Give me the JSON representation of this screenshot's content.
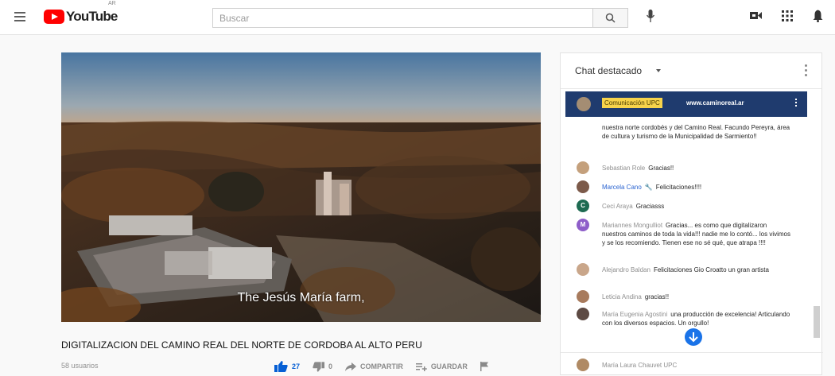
{
  "header": {
    "logo_text": "YouTube",
    "logo_suffix": "AR",
    "search_placeholder": "Buscar"
  },
  "video": {
    "subtitle": "The Jesús María farm,",
    "title": "DIGITALIZACION DEL CAMINO REAL DEL NORTE DE CORDOBA AL ALTO PERU",
    "viewers": "58 usuarios",
    "likes": "27",
    "dislikes": "0",
    "share_label": "COMPARTIR",
    "save_label": "GUARDAR"
  },
  "chat": {
    "title": "Chat destacado",
    "pinned": {
      "author": "Comunicación UPC",
      "text": "www.caminoreal.ar"
    },
    "messages": [
      {
        "author": "",
        "text": "nuestra norte cordobés y del Camino Real. Facundo Pereyra, área de cultura y turismo de la Municipalidad de Sarmiento!!",
        "avatar_color": "",
        "initial": ""
      },
      {
        "author": "Sebastian Role",
        "text": "Gracias!!",
        "avatar_color": "#c4a07c",
        "initial": ""
      },
      {
        "author": "Marcela Cano",
        "text": "Felicitaciones!!!!",
        "avatar_color": "#7c5a4a",
        "initial": "",
        "moderator": true
      },
      {
        "author": "Ceci Araya",
        "text": "Graciasss",
        "avatar_color": "#1e6b52",
        "initial": "C"
      },
      {
        "author": "Mariannes Mongulliot",
        "text": "Gracias... es como que digitalizaron nuestros caminos de toda la vida!!! nadie me lo contó... los vivimos y se los recomiendo. Tienen ese no sé qué, que atrapa !!!!",
        "avatar_color": "#8e5ec9",
        "initial": "M"
      },
      {
        "author": "Alejandro Baldan",
        "text": "Felicitaciones Gio Croatto un gran artista",
        "avatar_color": "#c9a68a",
        "initial": ""
      },
      {
        "author": "Leticia Andina",
        "text": "gracias!!",
        "avatar_color": "#a87b5d",
        "initial": ""
      },
      {
        "author": "María Eugenia Agostini",
        "text": "una producción de excelencia! Articulando con los diversos espacios. Un orgullo!",
        "avatar_color": "#5d4a43",
        "initial": ""
      }
    ],
    "footer_author": "María Laura Chauvet UPC"
  }
}
